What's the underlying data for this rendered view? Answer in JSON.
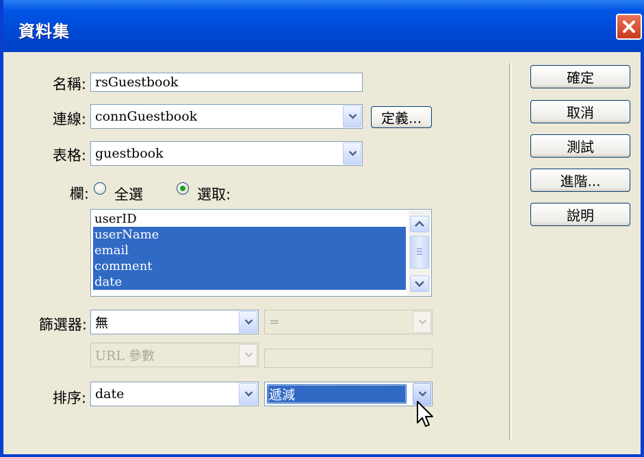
{
  "window": {
    "title": "資料集"
  },
  "form": {
    "name": {
      "label": "名稱:",
      "value": "rsGuestbook"
    },
    "connection": {
      "label": "連線:",
      "value": "connGuestbook",
      "define_label": "定義..."
    },
    "table": {
      "label": "表格:",
      "value": "guestbook"
    },
    "columns": {
      "label": "欄:",
      "option_all": "全選",
      "option_selected": "選取:",
      "selected_option": "選取:",
      "items": [
        {
          "label": "userID",
          "selected": false
        },
        {
          "label": "userName",
          "selected": true
        },
        {
          "label": "email",
          "selected": true
        },
        {
          "label": "comment",
          "selected": true
        },
        {
          "label": "date",
          "selected": true
        }
      ]
    },
    "filter": {
      "label": "篩選器:",
      "column_value": "無",
      "operator_value": "=",
      "source_value": "URL 參數",
      "param_value": ""
    },
    "sort": {
      "label": "排序:",
      "column_value": "date",
      "direction_value": "遞減"
    }
  },
  "buttons": {
    "ok": "確定",
    "cancel": "取消",
    "test": "測試",
    "advanced": "進階...",
    "help": "說明"
  },
  "colors": {
    "titlebar": "#0055e5",
    "selection": "#316ac5",
    "dialog_bg": "#ece9d8",
    "close": "#d9461c"
  }
}
